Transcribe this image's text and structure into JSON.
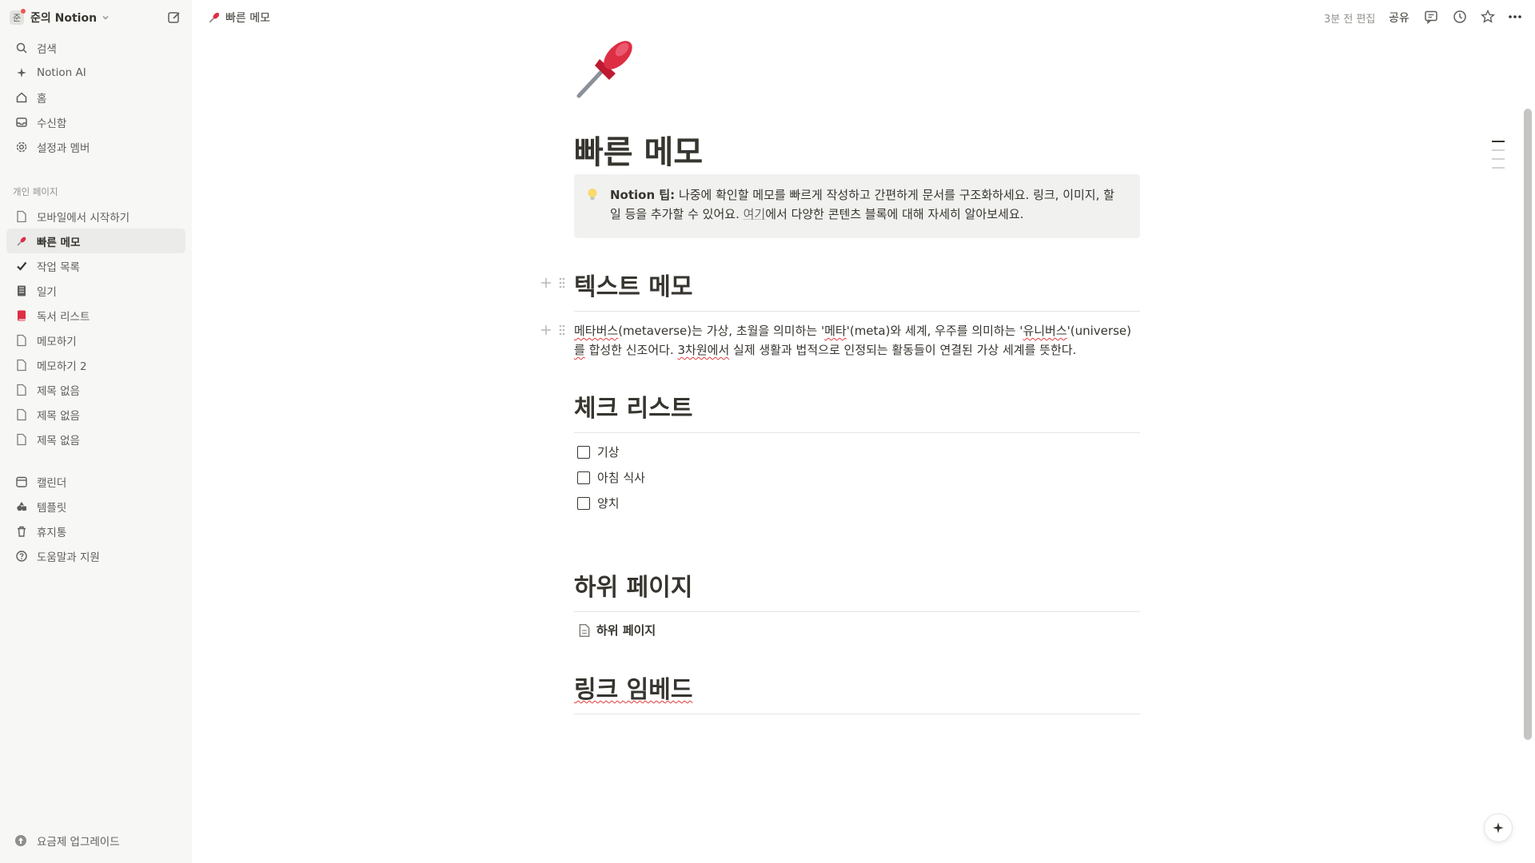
{
  "sidebar": {
    "workspace": {
      "avatar": "준",
      "name": "준의 Notion"
    },
    "top_items": [
      {
        "label": "검색",
        "icon": "search-icon"
      },
      {
        "label": "Notion AI",
        "icon": "sparkle-icon"
      },
      {
        "label": "홈",
        "icon": "home-icon"
      },
      {
        "label": "수신함",
        "icon": "inbox-icon"
      },
      {
        "label": "설정과 멤버",
        "icon": "gear-icon"
      }
    ],
    "section_label": "개인 페이지",
    "pages": [
      {
        "label": "모바일에서 시작하기",
        "icon": "page-icon"
      },
      {
        "label": "빠른 메모",
        "icon": "pushpin-icon",
        "active": true
      },
      {
        "label": "작업 목록",
        "icon": "checkmark-icon"
      },
      {
        "label": "일기",
        "icon": "notebook-icon"
      },
      {
        "label": "독서 리스트",
        "icon": "red-book-icon"
      },
      {
        "label": "메모하기",
        "icon": "page-icon"
      },
      {
        "label": "메모하기 2",
        "icon": "page-icon"
      },
      {
        "label": "제목 없음",
        "icon": "page-icon"
      },
      {
        "label": "제목 없음",
        "icon": "page-icon"
      },
      {
        "label": "제목 없음",
        "icon": "page-icon"
      }
    ],
    "bottom_items": [
      {
        "label": "캘린더",
        "icon": "calendar-icon"
      },
      {
        "label": "템플릿",
        "icon": "shapes-icon"
      },
      {
        "label": "휴지통",
        "icon": "trash-icon"
      },
      {
        "label": "도움말과 지원",
        "icon": "help-icon"
      }
    ],
    "upgrade": "요금제 업그레이드"
  },
  "topbar": {
    "breadcrumb": "빠른 메모",
    "edited": "3분 전 편집",
    "share": "공유"
  },
  "page": {
    "title": "빠른 메모",
    "callout": {
      "bold": "Notion 팁:",
      "text1": " 나중에 확인할 메모를 빠르게 작성하고 간편하게 문서를 구조화하세요. 링크, 이미지, 할 일 등을 추가할 수 있어요. ",
      "link": "여기",
      "text2": "에서 다양한 콘텐츠 블록에 대해 자세히 알아보세요."
    },
    "h_text": "텍스트 메모",
    "para": {
      "p1": "메타버스",
      "p2": "(metaverse)는 가상, 초월을 의미하는 '",
      "p3": "메타",
      "p4": "'(meta)와 세계, 우주를 의미하는 '",
      "p5": "유니버스",
      "p6": "'(universe)",
      "p7": "를",
      "p8": " 합성한 신조어다. ",
      "p9": "3차원에서",
      "p10": " 실제 생활과 법적으로 인정되는 활동들이 연결된 가상 세계를 뜻한다."
    },
    "h_check": "체크 리스트",
    "checklist": [
      "기상",
      "아침 식사",
      "양치"
    ],
    "h_sub": "하위 페이지",
    "subpage": "하위 페이지",
    "h_link": "링크 임베드"
  }
}
